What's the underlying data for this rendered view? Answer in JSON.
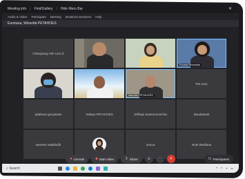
{
  "titlebar": {
    "items": [
      "Meeting info",
      "Find/Gallery",
      "Hide Meru Bar"
    ],
    "close_icon": "close-icon"
  },
  "menubar": {
    "items": [
      "Audio & Video",
      "Participant",
      "Meeting",
      "Breakout Sessions",
      "Help"
    ]
  },
  "meetingbar": {
    "title": "Eunmara, Winsofat PETAHOES"
  },
  "tiles": [
    {
      "name": "Chewjuang Yeh Lien D",
      "has_video": false
    },
    {
      "name": "",
      "has_video": true
    },
    {
      "name": "",
      "has_video": true
    },
    {
      "name": "",
      "label": "Puuma Simanbas",
      "has_video": true
    },
    {
      "name": "",
      "has_video": true
    },
    {
      "name": "",
      "has_video": true
    },
    {
      "name": "",
      "label": "Marcello PETAHOES",
      "has_video": true
    },
    {
      "name": "Pet orou",
      "has_video": false
    },
    {
      "name": "pdahees gooyawas",
      "has_video": false
    },
    {
      "name": "Safaya PETAHOES",
      "has_video": false
    },
    {
      "name": "sefilaya anaemmond ba",
      "has_video": false
    },
    {
      "name": "Bauakasak",
      "has_video": false
    },
    {
      "name": "seereeu walefaufh",
      "has_video": false
    },
    {
      "name": "",
      "has_video": false,
      "avatar": true
    },
    {
      "name": "uenoa",
      "has_video": false
    },
    {
      "name": "Nole Wedlona",
      "has_video": false
    }
  ],
  "controls": {
    "unmute": "Unmute",
    "start_video": "Start video",
    "share": "Share",
    "participants": "Participants"
  },
  "taskbar": {
    "search": "Search"
  },
  "colors": {
    "accent": "#7cc1ff",
    "leave": "#d63b2f"
  }
}
